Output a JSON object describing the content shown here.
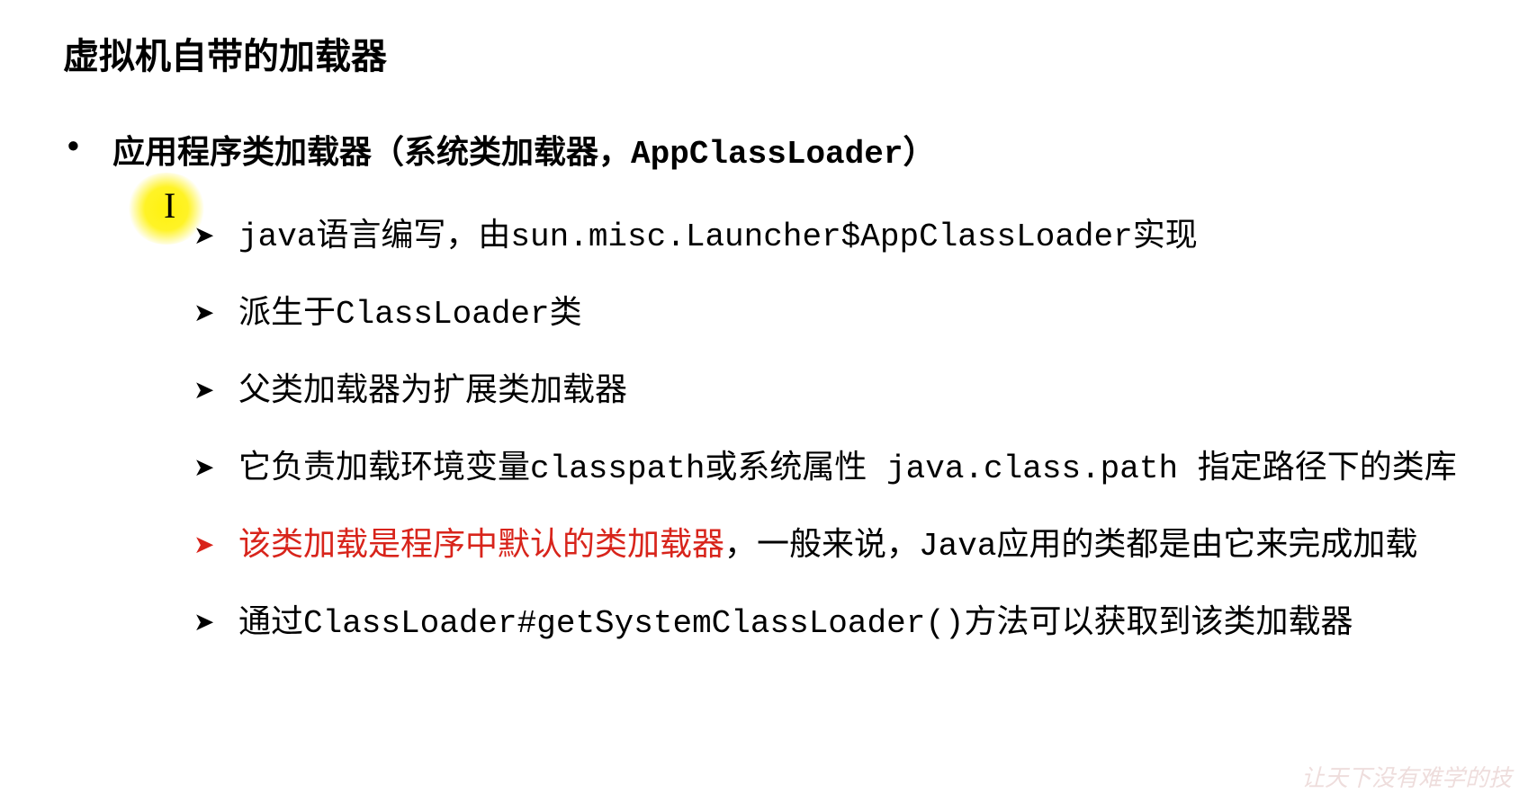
{
  "title": "虚拟机自带的加载器",
  "main_item": {
    "prefix": "应用程序类加载器（系统类加载器，",
    "mono": "AppClassLoader",
    "suffix": "）"
  },
  "sub_items": [
    {
      "text": "java语言编写，由sun.misc.Launcher$AppClassLoader实现",
      "highlight": false,
      "red_arrow": false
    },
    {
      "text": "派生于ClassLoader类",
      "highlight": false,
      "red_arrow": false
    },
    {
      "text": "父类加载器为扩展类加载器",
      "highlight": false,
      "red_arrow": false
    },
    {
      "text": "它负责加载环境变量classpath或系统属性 java.class.path 指定路径下的类库",
      "highlight": false,
      "red_arrow": false
    },
    {
      "red_prefix": "该类加载是程序中默认的类加载器",
      "rest": "，一般来说，Java应用的类都是由它来完成加载",
      "highlight": true,
      "red_arrow": true
    },
    {
      "text": "通过ClassLoader#getSystemClassLoader()方法可以获取到该类加载器",
      "highlight": false,
      "red_arrow": false
    }
  ],
  "arrow_glyph": "➤",
  "cursor_glyph": "I",
  "watermark": "让天下没有难学的技"
}
